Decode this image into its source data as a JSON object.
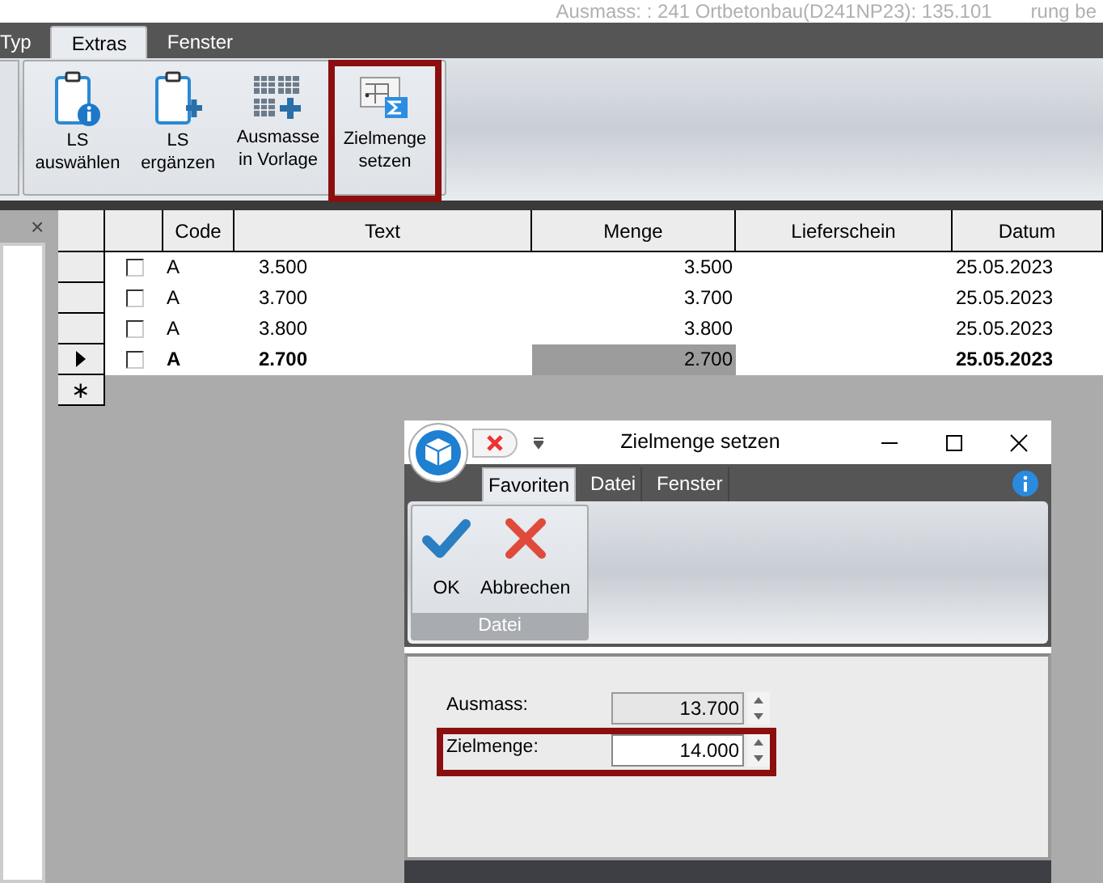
{
  "header": {
    "title_fragments": [
      "Ausmass: : 241 Ortbetonbau(D241NP23): 135.101",
      "rung be"
    ]
  },
  "tabs": [
    {
      "label": "Typ",
      "selected": false
    },
    {
      "label": "Extras",
      "selected": true
    },
    {
      "label": "Fenster",
      "selected": false
    }
  ],
  "ribbon": {
    "buttons": [
      {
        "kind": "clipboard-info",
        "lines": [
          "LS",
          "auswählen"
        ],
        "highlighted": false
      },
      {
        "kind": "clipboard-plus",
        "lines": [
          "LS",
          "ergänzen"
        ],
        "highlighted": false
      },
      {
        "kind": "table-plus",
        "lines": [
          "Ausmasse",
          "in Vorlage"
        ],
        "highlighted": false
      },
      {
        "kind": "sigma-doc",
        "lines": [
          "Zielmenge",
          "setzen"
        ],
        "highlighted": true
      }
    ]
  },
  "side_panel": {
    "close": "×"
  },
  "grid": {
    "columns": [
      "Code",
      "Text",
      "Menge",
      "Lieferschein",
      "Datum"
    ],
    "rows": [
      {
        "selected": false,
        "checked": false,
        "code": "A",
        "text": "3.500",
        "menge": "3.500",
        "datum": "25.05.2023"
      },
      {
        "selected": false,
        "checked": false,
        "code": "A",
        "text": "3.700",
        "menge": "3.700",
        "datum": "25.05.2023"
      },
      {
        "selected": false,
        "checked": false,
        "code": "A",
        "text": "3.800",
        "menge": "3.800",
        "datum": "25.05.2023"
      },
      {
        "selected": true,
        "checked": false,
        "code": "A",
        "text": "2.700",
        "menge": "2.700",
        "datum": "25.05.2023"
      }
    ],
    "new_row_marker": "∗"
  },
  "dialog": {
    "title": "Zielmenge setzen",
    "tabs": [
      {
        "label": "Favoriten",
        "selected": true
      },
      {
        "label": "Datei",
        "selected": false
      },
      {
        "label": "Fenster",
        "selected": false
      }
    ],
    "group": {
      "label": "Datei",
      "buttons": [
        {
          "kind": "ok",
          "label": "OK"
        },
        {
          "kind": "cancel",
          "label": "Abbrechen"
        }
      ]
    },
    "fields": [
      {
        "label": "Ausmass:",
        "value": "13.700",
        "readonly": true,
        "highlighted": false
      },
      {
        "label": "Zielmenge:",
        "value": "14.000",
        "readonly": false,
        "highlighted": true
      }
    ]
  }
}
